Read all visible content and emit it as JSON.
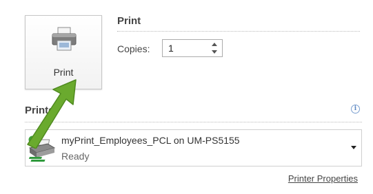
{
  "print_button": {
    "label": "Print",
    "icon": "printer-icon"
  },
  "print_section": {
    "title": "Print",
    "copies_label": "Copies:",
    "copies_value": "1"
  },
  "printer_section": {
    "title": "Printer",
    "info_icon": "info-icon",
    "selected_printer": {
      "name": "myPrint_Employees_PCL on UM-PS5155",
      "status": "Ready",
      "icon": "printer-ready-icon"
    },
    "properties_link": "Printer Properties"
  },
  "colors": {
    "arrow_green": "#6aaa2e",
    "border": "#c6c6c6",
    "text": "#444444",
    "info_blue": "#5b86c2"
  }
}
